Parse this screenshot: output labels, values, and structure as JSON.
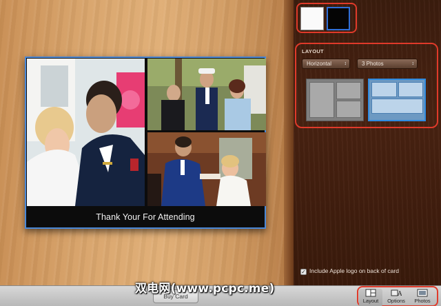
{
  "card": {
    "caption": "Thank Your For Attending",
    "photos": [
      "wedding-kiss-photo",
      "wedding-group-photo",
      "cake-cutting-photo"
    ]
  },
  "colors": {
    "selected": "black",
    "options": [
      "white",
      "black"
    ],
    "accent": "#2f6fd8",
    "highlight": "#e03a2a"
  },
  "layout": {
    "title": "LAYOUT",
    "orientation": "Horizontal",
    "photo_count": "3 Photos",
    "thumbnails": [
      {
        "name": "layout-thumb-1",
        "selected": false
      },
      {
        "name": "layout-thumb-2",
        "selected": true
      }
    ]
  },
  "options": {
    "apple_logo_label": "Include Apple logo on back of card",
    "apple_logo_checked": true
  },
  "toolbar": {
    "buy_label": "Buy Card",
    "layout_label": "Layout",
    "options_label": "Options",
    "photos_label": "Photos"
  },
  "watermark": "双电网(www.pcpc.me)"
}
